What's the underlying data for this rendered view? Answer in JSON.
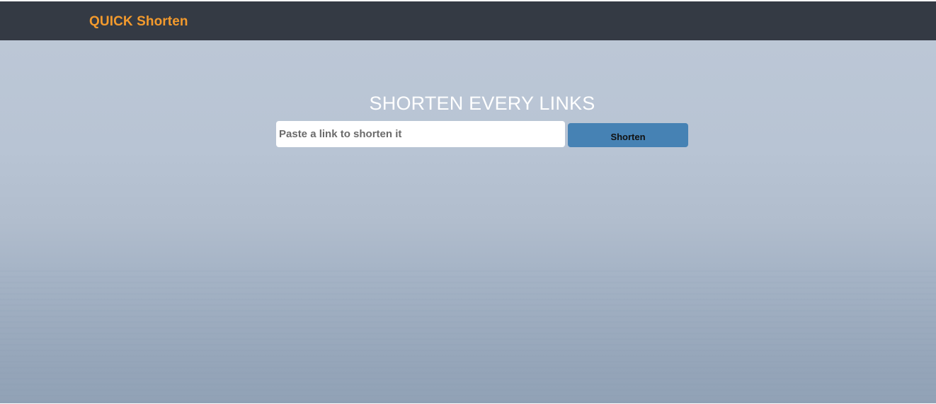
{
  "navbar": {
    "brand": "QUICK Shorten"
  },
  "hero": {
    "title": "SHORTEN EVERY LINKS",
    "input": {
      "placeholder": "Paste a link to shorten it",
      "value": ""
    },
    "shorten_label": "Shorten"
  },
  "colors": {
    "navbar_bg": "#343a44",
    "brand": "#f39a2d",
    "button_bg": "#4682b4",
    "title_text": "#ffffff"
  }
}
